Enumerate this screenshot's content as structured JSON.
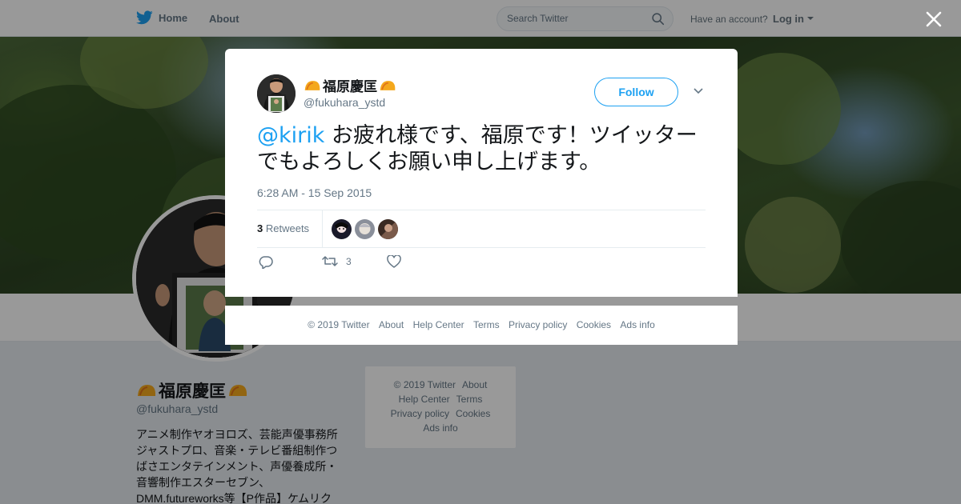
{
  "nav": {
    "home_label": "Home",
    "about_label": "About",
    "search_placeholder": "Search Twitter",
    "have_account": "Have an account?",
    "login_label": "Log in"
  },
  "profile": {
    "name": "福原慶匡",
    "handle": "@fukuhara_ystd",
    "bio": "アニメ制作ヤオヨロズ、芸能声優事務所ジャストプロ、音楽・テレビ番組制作つばさエンタテインメント、声優養成所・音響制作エスターセブン、DMM.futureworks等【P作品】ケムリク"
  },
  "side_footer": {
    "items": [
      "© 2019 Twitter",
      "About",
      "Help Center",
      "Terms",
      "Privacy policy",
      "Cookies",
      "Ads info"
    ]
  },
  "tweet": {
    "author_name": "福原慶匡",
    "author_handle": "@fukuhara_ystd",
    "follow_label": "Follow",
    "mention": "@kirik",
    "text": " お疲れ様です、福原です！ツイッターでもよろしくお願い申し上げます。",
    "timestamp": "6:28 AM - 15 Sep 2015",
    "retweet_count": "3",
    "retweet_label": "Retweets",
    "action_retweet_count": "3"
  },
  "modal_footer": {
    "items": [
      "© 2019 Twitter",
      "About",
      "Help Center",
      "Terms",
      "Privacy policy",
      "Cookies",
      "Ads info"
    ]
  },
  "colors": {
    "twitter_blue": "#1da1f2",
    "muted_text": "#657786",
    "emoji_orange": "#f4a81d"
  },
  "icons": {
    "logo": "twitter-bird-icon",
    "search": "search-icon",
    "close": "close-icon",
    "more": "chevron-down-icon",
    "reply": "reply-icon",
    "retweet": "retweet-icon",
    "like": "heart-icon",
    "name_emoji": "taco-icon"
  }
}
